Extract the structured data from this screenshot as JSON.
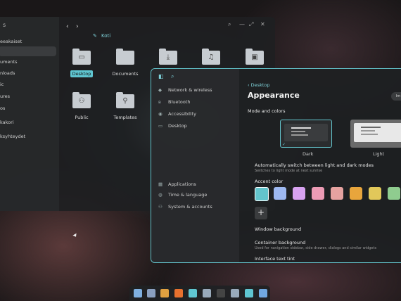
{
  "file_manager": {
    "title": "s",
    "sidebar": [
      {
        "label": "eeakaiset"
      },
      {
        "label": ""
      },
      {
        "label": "uments"
      },
      {
        "label": "nloads"
      },
      {
        "label": "ic"
      },
      {
        "label": "ures"
      },
      {
        "label": "os"
      },
      {
        "label": "kakori"
      },
      {
        "label": "ksyhteydet"
      }
    ],
    "nav_back": "‹",
    "nav_forward": "›",
    "breadcrumb": "Koti",
    "window_controls": [
      "⌕",
      "—",
      "⤢",
      "✕"
    ],
    "folders": [
      {
        "name": "Desktop",
        "icon": "desktop-folder-icon",
        "glyph": "▭",
        "selected": true
      },
      {
        "name": "Documents",
        "icon": "documents-folder-icon",
        "glyph": "",
        "selected": false
      },
      {
        "name": "",
        "icon": "downloads-folder-icon",
        "glyph": "⤓",
        "selected": false
      },
      {
        "name": "",
        "icon": "music-folder-icon",
        "glyph": "♫",
        "selected": false
      },
      {
        "name": "",
        "icon": "pictures-folder-icon",
        "glyph": "▣",
        "selected": false
      },
      {
        "name": "Public",
        "icon": "public-folder-icon",
        "glyph": "⚇",
        "selected": false
      },
      {
        "name": "Templates",
        "icon": "templates-folder-icon",
        "glyph": "⚲",
        "selected": false
      }
    ]
  },
  "settings": {
    "sidebar": [
      {
        "label": "Network & wireless",
        "icon": "wifi-icon",
        "glyph": "◆"
      },
      {
        "label": "Bluetooth",
        "icon": "bluetooth-icon",
        "glyph": "ʙ"
      },
      {
        "label": "Accessibility",
        "icon": "accessibility-icon",
        "glyph": "◉"
      },
      {
        "label": "Desktop",
        "icon": "desktop-icon",
        "glyph": "▭"
      },
      {
        "label": "Applications",
        "icon": "apps-icon",
        "glyph": "▦"
      },
      {
        "label": "Time & language",
        "icon": "globe-icon",
        "glyph": "◍"
      },
      {
        "label": "System & accounts",
        "icon": "users-icon",
        "glyph": "⚇"
      }
    ],
    "back_label": "Desktop",
    "page_title": "Appearance",
    "pill_label": "Im",
    "mode_section": "Mode and colors",
    "modes": [
      {
        "label": "Dark",
        "selected": true
      },
      {
        "label": "Light",
        "selected": false
      }
    ],
    "auto_switch_label": "Automatically switch between light and dark modes",
    "auto_switch_sub": "Switches to light mode at next sunrise",
    "accent_label": "Accent color",
    "accents": [
      "#63c4cc",
      "#9db8f0",
      "#d7a2f0",
      "#ec9bb5",
      "#e6a2a0",
      "#e8a53c",
      "#e2c85a",
      "#8fcc8f"
    ],
    "add_label": "+",
    "window_bg_label": "Window background",
    "container_bg_label": "Container background",
    "container_bg_sub": "Used for navigation sidebar, side drawer, dialogs and similar widgets",
    "text_tint_label": "Interface text tint"
  },
  "dock": {
    "apps": [
      {
        "icon": "launcher-icon",
        "color": "#7fb0e0"
      },
      {
        "icon": "workspaces-icon",
        "color": "#8aa0c0"
      },
      {
        "icon": "app-grid-icon",
        "color": "#e0a040"
      },
      {
        "icon": "firefox-icon",
        "color": "#e6702e"
      },
      {
        "icon": "files-icon",
        "color": "#5fc6d1"
      },
      {
        "icon": "editor-icon",
        "color": "#9ab"
      },
      {
        "icon": "terminal-icon",
        "color": "#444"
      },
      {
        "icon": "store-icon",
        "color": "#9ab"
      },
      {
        "icon": "settings-icon",
        "color": "#5fc6d1"
      },
      {
        "icon": "calculator-icon",
        "color": "#6fa8e0"
      }
    ]
  }
}
